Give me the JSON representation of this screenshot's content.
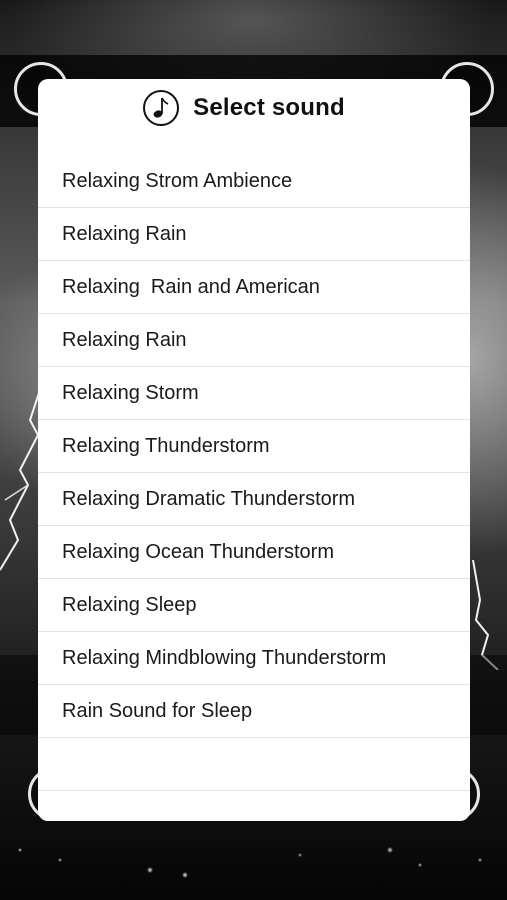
{
  "modal": {
    "title": "Select sound",
    "icon": "music-note-icon"
  },
  "sounds": [
    "Relaxing Strom Ambience",
    "Relaxing Rain",
    "Relaxing  Rain and American",
    "Relaxing Rain",
    "Relaxing Storm",
    "Relaxing Thunderstorm",
    "Relaxing Dramatic Thunderstorm",
    "Relaxing Ocean Thunderstorm",
    "Relaxing Sleep",
    "Relaxing Mindblowing Thunderstorm",
    "Rain Sound for Sleep",
    ""
  ],
  "colors": {
    "sheet_background": "#ffffff",
    "text": "#1a1a1a",
    "divider": "#e2e2e2"
  }
}
